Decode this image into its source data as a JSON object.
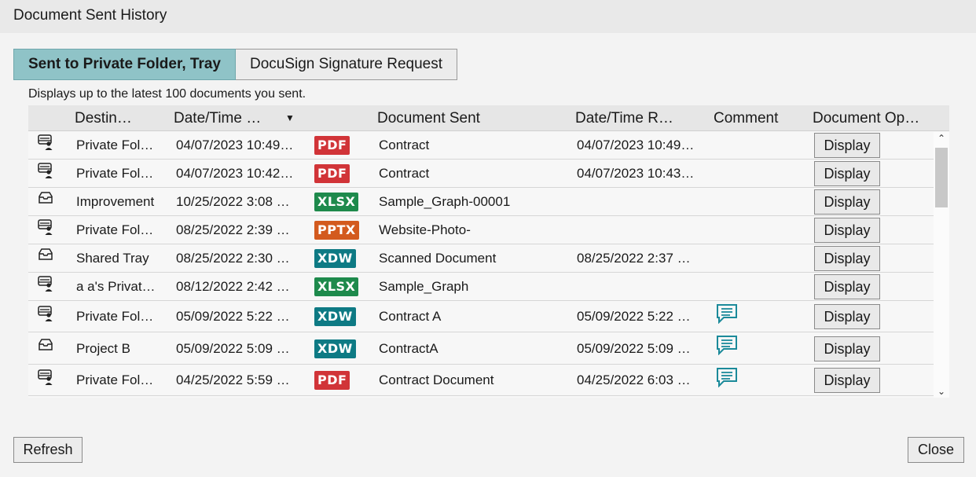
{
  "window": {
    "title": "Document Sent History"
  },
  "tabs": [
    {
      "label": "Sent to Private Folder, Tray",
      "active": true
    },
    {
      "label": "DocuSign Signature Request",
      "active": false
    }
  ],
  "description": "Displays up to the latest 100 documents you sent.",
  "table": {
    "columns": {
      "destination": "Destin…",
      "date_sent": "Date/Time …",
      "document": "Document Sent",
      "date_received": "Date/Time R…",
      "comment": "Comment",
      "options": "Document Op…"
    },
    "sort_indicator": "▼",
    "rows": [
      {
        "icon": "private-folder-icon",
        "destination": "Private Fol…",
        "date_sent": "04/07/2023 10:49…",
        "type": "PDF",
        "document": "Contract",
        "date_received": "04/07/2023 10:49…",
        "comment": false,
        "action": "Display"
      },
      {
        "icon": "private-folder-icon",
        "destination": "Private Fol…",
        "date_sent": "04/07/2023 10:42…",
        "type": "PDF",
        "document": "Contract",
        "date_received": "04/07/2023 10:43…",
        "comment": false,
        "action": "Display"
      },
      {
        "icon": "tray-icon",
        "destination": "Improvement",
        "date_sent": "10/25/2022 3:08 …",
        "type": "XLSX",
        "document": "Sample_Graph-00001",
        "date_received": "",
        "comment": false,
        "action": "Display"
      },
      {
        "icon": "private-folder-icon",
        "destination": "Private Fol…",
        "date_sent": "08/25/2022 2:39 …",
        "type": "PPTX",
        "document": "Website-Photo-",
        "date_received": "",
        "comment": false,
        "action": "Display"
      },
      {
        "icon": "tray-icon",
        "destination": "Shared Tray",
        "date_sent": "08/25/2022 2:30 …",
        "type": "XDW",
        "document": "Scanned Document",
        "date_received": "08/25/2022 2:37 …",
        "comment": false,
        "action": "Display"
      },
      {
        "icon": "private-folder-icon",
        "destination": "a a's Privat…",
        "date_sent": "08/12/2022 2:42 …",
        "type": "XLSX",
        "document": "Sample_Graph",
        "date_received": "",
        "comment": false,
        "action": "Display"
      },
      {
        "icon": "private-folder-icon",
        "destination": "Private Fol…",
        "date_sent": "05/09/2022 5:22 …",
        "type": "XDW",
        "document": "Contract A",
        "date_received": "05/09/2022 5:22 …",
        "comment": true,
        "action": "Display"
      },
      {
        "icon": "tray-icon",
        "destination": "Project B",
        "date_sent": "05/09/2022 5:09 …",
        "type": "XDW",
        "document": "ContractA",
        "date_received": "05/09/2022 5:09 …",
        "comment": true,
        "action": "Display"
      },
      {
        "icon": "private-folder-icon",
        "destination": "Private Fol…",
        "date_sent": "04/25/2022 5:59 …",
        "type": "PDF",
        "document": "Contract Document",
        "date_received": "04/25/2022 6:03 …",
        "comment": true,
        "action": "Display"
      },
      {
        "icon": "private-folder-icon",
        "destination": "",
        "date_sent": "",
        "type": "",
        "document": "",
        "date_received": "",
        "comment": true,
        "action": ""
      }
    ]
  },
  "badge_colors": {
    "PDF": "#d13438",
    "XLSX": "#1e8a4c",
    "PPTX": "#d35a1e",
    "XDW": "#0e7a84"
  },
  "comment_icon_color": "#1b8a9a",
  "footer": {
    "refresh_label": "Refresh",
    "close_label": "Close"
  }
}
